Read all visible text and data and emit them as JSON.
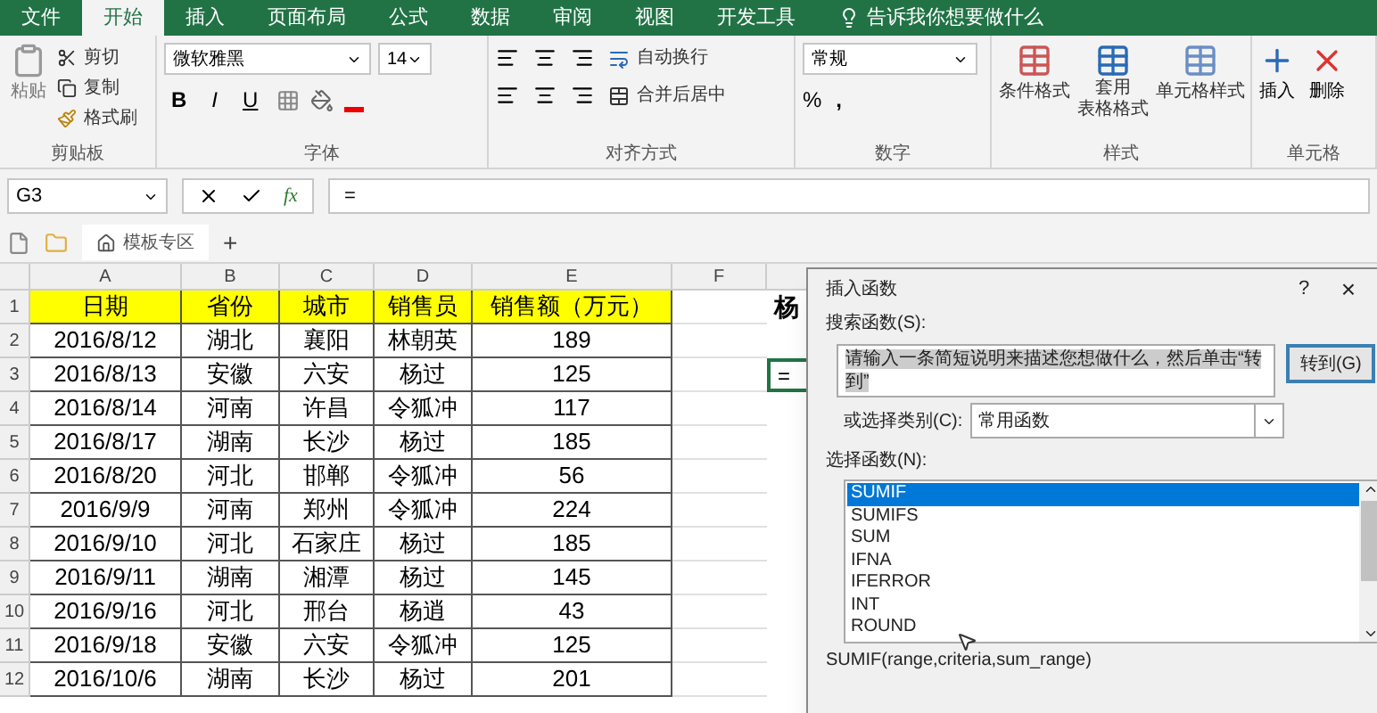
{
  "menu_tabs": [
    {
      "label": "文件",
      "selected": false
    },
    {
      "label": "开始",
      "selected": true
    },
    {
      "label": "插入",
      "selected": false
    },
    {
      "label": "页面布局",
      "selected": false
    },
    {
      "label": "公式",
      "selected": false
    },
    {
      "label": "数据",
      "selected": false
    },
    {
      "label": "审阅",
      "selected": false
    },
    {
      "label": "视图",
      "selected": false
    },
    {
      "label": "开发工具",
      "selected": false
    }
  ],
  "tell_me": "告诉我你想要做什么",
  "ribbon": {
    "clipboard": {
      "paste": "粘贴",
      "cut": "剪切",
      "copy": "复制",
      "format_painter": "格式刷",
      "title": "剪贴板"
    },
    "font": {
      "name": "微软雅黑",
      "size": "14",
      "bold": "B",
      "italic": "I",
      "underline": "U",
      "title": "字体"
    },
    "alignment": {
      "wrap": "自动换行",
      "merge": "合并后居中",
      "title": "对齐方式"
    },
    "number": {
      "format": "常规",
      "percent": "%",
      "comma": ",",
      "title": "数字"
    },
    "styles": {
      "conditional": "条件格式",
      "table_line1": "套用",
      "table_line2": "表格格式",
      "cell_styles": "单元格样式",
      "title": "样式"
    },
    "cells": {
      "insert": "插入",
      "delete": "删除",
      "title": "单元格"
    }
  },
  "formula_bar": {
    "name_box": "G3",
    "fx": "fx",
    "formula": "="
  },
  "sheet_tabs": {
    "template": "模板专区",
    "add": "+"
  },
  "columns": [
    "A",
    "B",
    "C",
    "D",
    "E",
    "F"
  ],
  "header_row": {
    "number": "1",
    "cells": [
      "日期",
      "省份",
      "城市",
      "销售员",
      "销售额（万元）"
    ]
  },
  "rows": [
    {
      "number": "2",
      "cells": [
        "2016/8/12",
        "湖北",
        "襄阳",
        "林朝英",
        "189"
      ]
    },
    {
      "number": "3",
      "cells": [
        "2016/8/13",
        "安徽",
        "六安",
        "杨过",
        "125"
      ]
    },
    {
      "number": "4",
      "cells": [
        "2016/8/14",
        "河南",
        "许昌",
        "令狐冲",
        "117"
      ]
    },
    {
      "number": "5",
      "cells": [
        "2016/8/17",
        "湖南",
        "长沙",
        "杨过",
        "185"
      ]
    },
    {
      "number": "6",
      "cells": [
        "2016/8/20",
        "河北",
        "邯郸",
        "令狐冲",
        "56"
      ]
    },
    {
      "number": "7",
      "cells": [
        "2016/9/9",
        "河南",
        "郑州",
        "令狐冲",
        "224"
      ]
    },
    {
      "number": "8",
      "cells": [
        "2016/9/10",
        "河北",
        "石家庄",
        "杨过",
        "185"
      ]
    },
    {
      "number": "9",
      "cells": [
        "2016/9/11",
        "湖南",
        "湘潭",
        "杨过",
        "145"
      ]
    },
    {
      "number": "10",
      "cells": [
        "2016/9/16",
        "河北",
        "邢台",
        "杨逍",
        "43"
      ]
    },
    {
      "number": "11",
      "cells": [
        "2016/9/18",
        "安徽",
        "六安",
        "令狐冲",
        "125"
      ]
    },
    {
      "number": "12",
      "cells": [
        "2016/10/6",
        "湖南",
        "长沙",
        "杨过",
        "201"
      ]
    }
  ],
  "side_cells": {
    "row1": "杨",
    "row3": "="
  },
  "dialog": {
    "title": "插入函数",
    "help": "?",
    "close": "×",
    "search_label": "搜索函数(S):",
    "search_value": "请输入一条简短说明来描述您想做什么，然后单击“转到”",
    "go_button": "转到(G)",
    "category_label": "或选择类别(C):",
    "category": "常用函数",
    "list_label": "选择函数(N):",
    "functions": [
      {
        "name": "SUMIF",
        "selected": true
      },
      {
        "name": "SUMIFS",
        "selected": false
      },
      {
        "name": "SUM",
        "selected": false
      },
      {
        "name": "IFNA",
        "selected": false
      },
      {
        "name": "IFERROR",
        "selected": false
      },
      {
        "name": "INT",
        "selected": false
      },
      {
        "name": "ROUND",
        "selected": false
      }
    ],
    "signature": "SUMIF(range,criteria,sum_range)"
  }
}
